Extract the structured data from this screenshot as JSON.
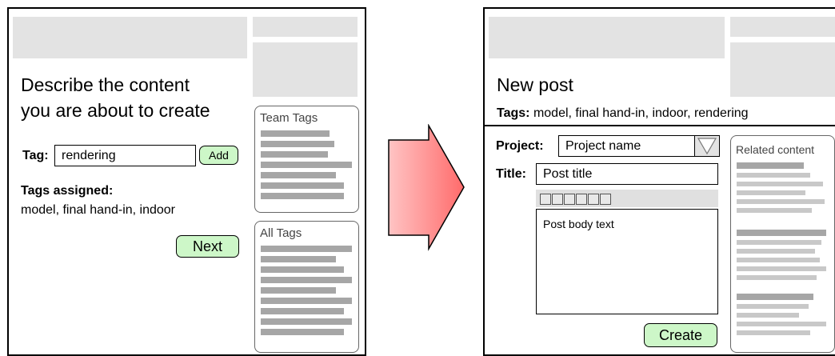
{
  "left_screen": {
    "heading_line1": "Describe the content",
    "heading_line2": "you are about to create",
    "tag_label": "Tag:",
    "tag_input_value": "rendering",
    "add_button": "Add",
    "tags_assigned_label": "Tags assigned:",
    "tags_assigned_value": "model, final hand-in, indoor",
    "next_button": "Next",
    "team_tags_title": "Team Tags",
    "all_tags_title": "All Tags"
  },
  "right_screen": {
    "heading": "New post",
    "tags_label": "Tags:",
    "tags_value": "model, final hand-in, indoor, rendering",
    "project_label": "Project:",
    "project_value": "Project name",
    "title_label": "Title:",
    "title_value": "Post title",
    "body_text": "Post body text",
    "create_button": "Create",
    "related_title": "Related content"
  },
  "colors": {
    "placeholder_gray": "#e3e3e3",
    "bar_gray": "#a6a6a6",
    "button_green": "#cdf7c8",
    "arrow_gradient_start": "#ffc4c4",
    "arrow_gradient_end": "#ff6b6b"
  }
}
